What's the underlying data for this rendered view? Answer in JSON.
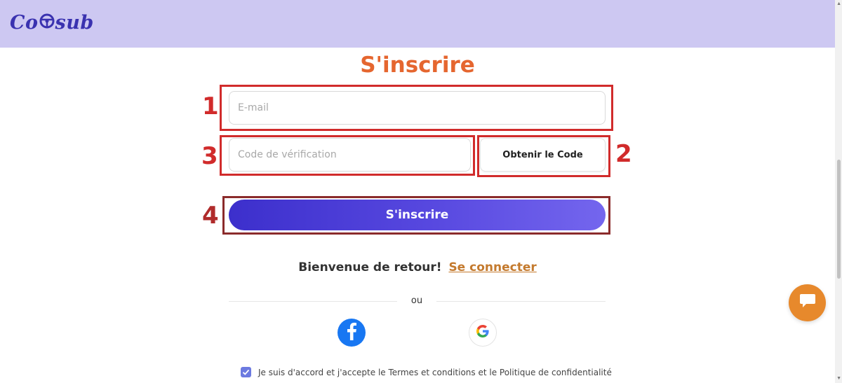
{
  "brand": {
    "logo_prefix": "Co",
    "logo_suffix": "sub"
  },
  "form": {
    "title": "S'inscrire",
    "email_placeholder": "E-mail",
    "code_placeholder": "Code de vérification",
    "get_code_label": "Obtenir le Code",
    "submit_label": "S'inscrire"
  },
  "annotations": [
    "1",
    "2",
    "3",
    "4"
  ],
  "login_prompt": {
    "text": "Bienvenue de retour!",
    "link": "Se connecter"
  },
  "separator": "ou",
  "social": [
    "facebook-icon",
    "google-icon"
  ],
  "terms": {
    "checked": true,
    "text": "Je suis d'accord et j'accepte le Termes et conditions et le Politique de confidentialité"
  },
  "colors": {
    "header": "#cdc8f2",
    "title": "#e5662f",
    "annotation": "#d12b2b",
    "primary": "#4a3ed8",
    "link": "#c47a2e",
    "chat": "#e7892c"
  }
}
